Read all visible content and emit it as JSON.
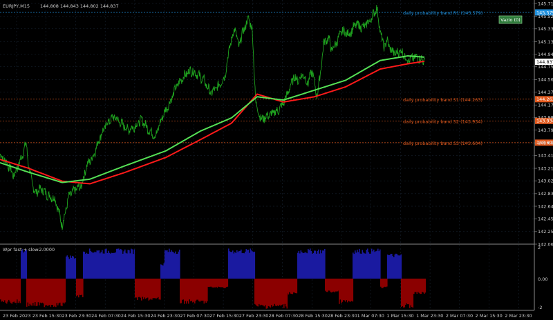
{
  "header": {
    "symbol": "EURJPY,M15",
    "ohlc": "144.808 144.843 144.802 144.837"
  },
  "button": {
    "label": "Vazio (0)"
  },
  "price_axis": {
    "ticks": [
      "145.715",
      "145.520",
      "145.330",
      "145.135",
      "144.945",
      "144.755",
      "144.560",
      "144.370",
      "144.175",
      "143.985",
      "143.795",
      "143.600",
      "143.410",
      "143.215",
      "143.025",
      "142.830",
      "142.640",
      "142.450",
      "142.255",
      "142.065"
    ],
    "current_price": "144.837"
  },
  "bands": [
    {
      "name": "daily probability band R1 (145.579)",
      "value": 145.579,
      "tag": "145.579",
      "color": "#1f8fdc"
    },
    {
      "name": "daily probability band S1 (144.263)",
      "value": 144.263,
      "tag": "144.263",
      "color": "#e25a1e"
    },
    {
      "name": "daily probability band S2 (143.934)",
      "value": 143.934,
      "tag": "143.934",
      "color": "#e25a1e"
    },
    {
      "name": "daily probability band S3 (143.604)",
      "value": 143.604,
      "tag": "143.604",
      "color": "#e25a1e"
    }
  ],
  "time_axis": [
    "23 Feb 2023",
    "23 Feb 15:30",
    "23 Feb 23:30",
    "24 Feb 07:30",
    "24 Feb 15:30",
    "24 Feb 23:30",
    "27 Feb 07:30",
    "27 Feb 15:30",
    "27 Feb 23:30",
    "28 Feb 07:30",
    "28 Feb 15:30",
    "28 Feb 23:30",
    "1 Mar 07:30",
    "1 Mar 15:30",
    "1 Mar 23:30",
    "2 Mar 07:30",
    "2 Mar 15:30",
    "2 Mar 23:30"
  ],
  "indicator": {
    "label": "Wpr fast + slow",
    "value": "-2.0000",
    "ticks": [
      "2",
      "0.00",
      "-2"
    ]
  },
  "colors": {
    "price_line": "#1fa31f",
    "ma_green": "#55e055",
    "ma_red": "#ff1a1a",
    "bull": "#1a1aa0",
    "bear": "#8b0000",
    "grid": "#1c2a3a"
  },
  "chart_data": {
    "type": "line",
    "title": "EURJPY,M15",
    "ylim": [
      142.065,
      145.715
    ],
    "price_keyframes": [
      [
        0,
        143.42
      ],
      [
        10,
        143.3
      ],
      [
        20,
        143.1
      ],
      [
        30,
        143.35
      ],
      [
        38,
        143.6
      ],
      [
        42,
        143.2
      ],
      [
        50,
        142.85
      ],
      [
        60,
        142.9
      ],
      [
        70,
        142.8
      ],
      [
        80,
        142.75
      ],
      [
        90,
        142.35
      ],
      [
        100,
        142.8
      ],
      [
        110,
        142.9
      ],
      [
        118,
        142.95
      ],
      [
        125,
        143.25
      ],
      [
        135,
        143.4
      ],
      [
        145,
        143.7
      ],
      [
        155,
        143.9
      ],
      [
        165,
        144.0
      ],
      [
        175,
        143.9
      ],
      [
        185,
        143.8
      ],
      [
        195,
        143.85
      ],
      [
        205,
        143.95
      ],
      [
        215,
        143.8
      ],
      [
        225,
        143.7
      ],
      [
        235,
        144.0
      ],
      [
        245,
        144.2
      ],
      [
        255,
        144.45
      ],
      [
        265,
        144.6
      ],
      [
        275,
        144.7
      ],
      [
        285,
        144.65
      ],
      [
        295,
        144.55
      ],
      [
        305,
        144.35
      ],
      [
        315,
        144.45
      ],
      [
        325,
        144.6
      ],
      [
        333,
        145.1
      ],
      [
        340,
        145.35
      ],
      [
        345,
        145.05
      ],
      [
        352,
        145.3
      ],
      [
        360,
        145.5
      ],
      [
        365,
        145.3
      ],
      [
        370,
        144.2
      ],
      [
        378,
        143.95
      ],
      [
        385,
        144.0
      ],
      [
        395,
        144.05
      ],
      [
        403,
        144.1
      ],
      [
        410,
        144.2
      ],
      [
        418,
        144.4
      ],
      [
        425,
        144.6
      ],
      [
        432,
        144.55
      ],
      [
        438,
        144.65
      ],
      [
        445,
        144.5
      ],
      [
        452,
        144.7
      ],
      [
        458,
        144.3
      ],
      [
        463,
        144.6
      ],
      [
        468,
        145.1
      ],
      [
        475,
        145.2
      ],
      [
        480,
        145.0
      ],
      [
        488,
        145.15
      ],
      [
        495,
        145.3
      ],
      [
        505,
        145.25
      ],
      [
        515,
        145.4
      ],
      [
        525,
        145.35
      ],
      [
        535,
        145.45
      ],
      [
        545,
        145.65
      ],
      [
        550,
        145.3
      ],
      [
        555,
        145.05
      ],
      [
        560,
        145.15
      ],
      [
        566,
        145.0
      ],
      [
        572,
        144.95
      ],
      [
        580,
        145.0
      ],
      [
        590,
        144.85
      ],
      [
        600,
        144.9
      ],
      [
        608,
        144.88
      ],
      [
        615,
        144.84
      ]
    ],
    "ma_green_keyframes": [
      [
        0,
        143.3
      ],
      [
        40,
        143.16
      ],
      [
        90,
        143.0
      ],
      [
        130,
        143.05
      ],
      [
        180,
        143.25
      ],
      [
        240,
        143.48
      ],
      [
        290,
        143.78
      ],
      [
        335,
        143.98
      ],
      [
        372,
        144.3
      ],
      [
        410,
        144.25
      ],
      [
        455,
        144.4
      ],
      [
        500,
        144.55
      ],
      [
        550,
        144.85
      ],
      [
        590,
        144.92
      ],
      [
        615,
        144.9
      ]
    ],
    "ma_red_keyframes": [
      [
        0,
        143.35
      ],
      [
        40,
        143.22
      ],
      [
        90,
        143.02
      ],
      [
        130,
        142.98
      ],
      [
        180,
        143.15
      ],
      [
        240,
        143.38
      ],
      [
        290,
        143.65
      ],
      [
        335,
        143.9
      ],
      [
        372,
        144.34
      ],
      [
        410,
        144.22
      ],
      [
        455,
        144.3
      ],
      [
        500,
        144.45
      ],
      [
        550,
        144.72
      ],
      [
        590,
        144.8
      ],
      [
        615,
        144.84
      ]
    ],
    "wpr_segments": [
      [
        0,
        30,
        -1.6
      ],
      [
        30,
        38,
        1.9
      ],
      [
        38,
        95,
        -1.8
      ],
      [
        95,
        110,
        1.5
      ],
      [
        110,
        120,
        -1.2
      ],
      [
        120,
        195,
        1.9
      ],
      [
        195,
        232,
        -1.4
      ],
      [
        232,
        238,
        1.0
      ],
      [
        238,
        260,
        1.9
      ],
      [
        260,
        300,
        -1.6
      ],
      [
        300,
        330,
        -0.6
      ],
      [
        330,
        368,
        1.9
      ],
      [
        368,
        415,
        -1.9
      ],
      [
        415,
        430,
        -1.0
      ],
      [
        430,
        470,
        1.9
      ],
      [
        470,
        490,
        -0.9
      ],
      [
        490,
        510,
        -1.6
      ],
      [
        510,
        550,
        1.9
      ],
      [
        550,
        560,
        -0.6
      ],
      [
        560,
        580,
        1.6
      ],
      [
        580,
        598,
        -1.9
      ],
      [
        598,
        615,
        -1.0
      ]
    ]
  }
}
